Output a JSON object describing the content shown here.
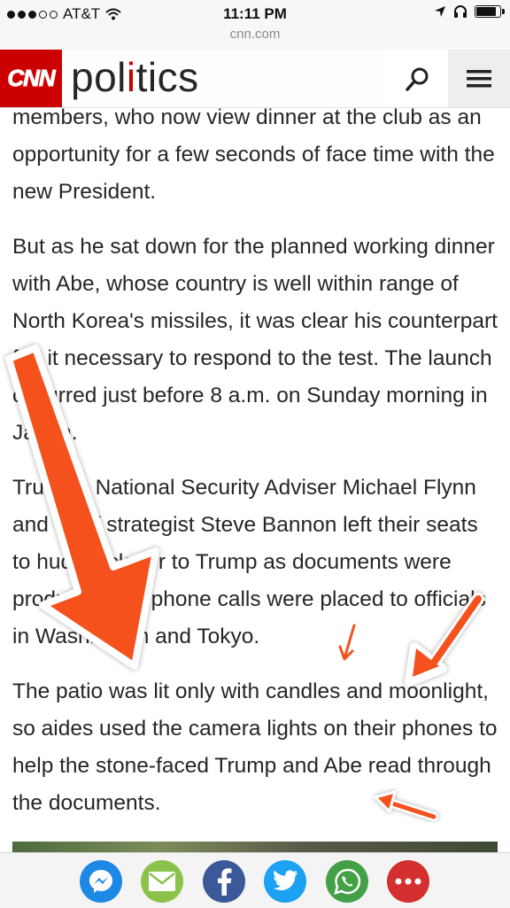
{
  "status_bar": {
    "carrier": "AT&T",
    "time": "11:11 PM",
    "url": "cnn.com",
    "signal_icons": [
      "signal-dot-filled",
      "signal-dot-filled",
      "signal-dot-filled",
      "signal-dot-empty",
      "signal-dot-empty"
    ],
    "battery_level": 0.8
  },
  "header": {
    "logo_text": "CNN",
    "section_pre": "pol",
    "section_accent": "i",
    "section_post": "tics",
    "search_icon": "search-icon",
    "menu_icon": "hamburger-menu-icon",
    "brand_color": "#cc0000"
  },
  "article": {
    "paragraphs": [
      "members, who now view dinner at the club as an opportunity for a few seconds of face time with the new President.",
      "But as he sat down for the planned working dinner with Abe, whose country is well within range of North Korea's missiles, it was clear his counterpart felt it necessary to respond to the test. The launch occurred just before 8 a.m. on Sunday morning in Japan.",
      "Trump's National Security Adviser Michael Flynn and chief strategist Steve Bannon left their seats to huddle closer to Trump as documents were produced and phone calls were placed to officials in Washington and Tokyo.",
      "The patio was lit only with candles and moonlight, so aides used the camera lights on their phones to help the stone-faced Trump and Abe read through the documents."
    ]
  },
  "annotations": {
    "arrow_color": "#f4511e",
    "arrows": [
      "large-arrow",
      "medium-arrow",
      "small-arrow",
      "bottom-arrow"
    ]
  },
  "share_bar": {
    "items": [
      {
        "name": "messenger",
        "color": "#1e88e5"
      },
      {
        "name": "email",
        "color": "#8bc34a"
      },
      {
        "name": "facebook",
        "color": "#3b5998"
      },
      {
        "name": "twitter",
        "color": "#1da1f2"
      },
      {
        "name": "whatsapp",
        "color": "#43a047"
      },
      {
        "name": "more",
        "color": "#d32f2f"
      }
    ]
  }
}
